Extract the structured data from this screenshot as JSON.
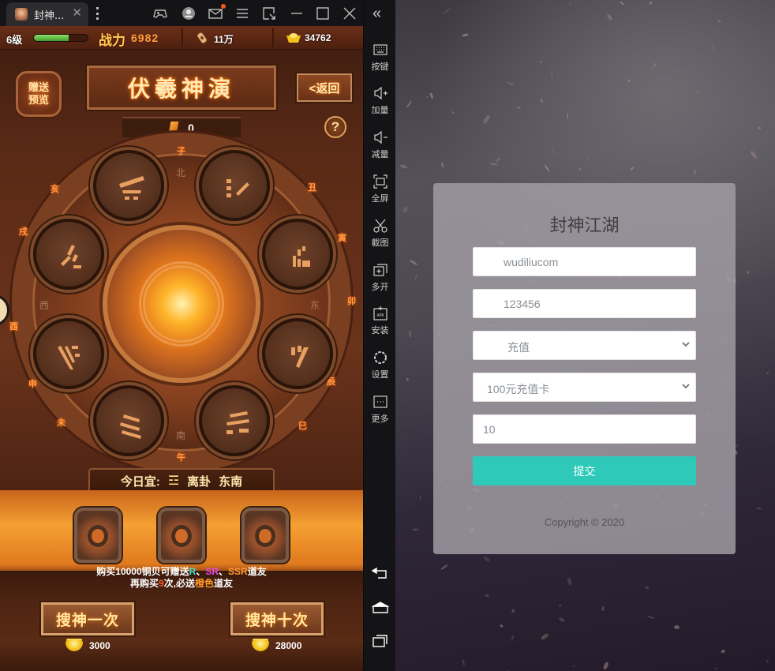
{
  "emulator": {
    "tab_title": "封神...",
    "tab_close": "✕",
    "toolbar_icons": [
      "gamepad-icon",
      "account-icon",
      "mail-icon",
      "menu-icon",
      "resize-icon",
      "minimize-icon",
      "maximize-icon",
      "close-icon"
    ],
    "collapse_glyph": "«",
    "sidebar": [
      {
        "icon": "keyboard-icon",
        "label": "按键"
      },
      {
        "icon": "volume-up-icon",
        "label": "加量"
      },
      {
        "icon": "volume-down-icon",
        "label": "减量"
      },
      {
        "icon": "fullscreen-icon",
        "label": "全屏"
      },
      {
        "icon": "scissors-icon",
        "label": "截图"
      },
      {
        "icon": "multi-instance-icon",
        "label": "多开"
      },
      {
        "icon": "apk-install-icon",
        "label": "安装"
      },
      {
        "icon": "settings-icon",
        "label": "设置"
      },
      {
        "icon": "more-icon",
        "label": "更多"
      }
    ],
    "nav_buttons": [
      "back-icon",
      "home-icon",
      "recents-icon"
    ]
  },
  "game": {
    "status": {
      "level": "6级",
      "exp_progress": 0.65,
      "power_label": "战力",
      "power_value": "6982",
      "copper": "11万",
      "gold": "34762"
    },
    "gift_preview": [
      "赠送",
      "预览"
    ],
    "title": "伏羲神演",
    "back_label": "<返回",
    "token_count": "0",
    "help_label": "?",
    "zodiac": [
      "子",
      "丑",
      "寅",
      "卯",
      "辰",
      "巳",
      "午",
      "未",
      "申",
      "酉",
      "戌",
      "亥"
    ],
    "directions": [
      "北",
      "东",
      "南",
      "西"
    ],
    "trigrams": [
      "乾",
      "兑",
      "离",
      "震",
      "巽",
      "坎",
      "艮",
      "坤"
    ],
    "today": {
      "label": "今日宜:",
      "glyph": "☲",
      "trigram": "离卦",
      "direction": "东南"
    },
    "notice": {
      "line1_prefix": "购买10000铜贝可赠送",
      "r": "R",
      "sep1": "、",
      "sr": "SR",
      "sep2": "、",
      "ssr": "SSR",
      "line1_suffix": "道友",
      "line2_prefix": "再购买",
      "count": "9",
      "line2_mid": "次,必送",
      "orange": "橙色",
      "line2_suffix": "道友"
    },
    "draw_once": {
      "label": "搜神一次",
      "cost": "3000"
    },
    "draw_ten": {
      "label": "搜神十次",
      "cost": "28000"
    },
    "colors": {
      "r": "#3ee0d0",
      "sr": "#e04ae8",
      "ssr": "#ff9a3a"
    }
  },
  "web": {
    "title": "封神江湖",
    "account_value": "wudiliucom",
    "password_value": "123456",
    "type_select": "充值",
    "product_select": "100元充值卡",
    "quantity_value": "10",
    "submit_label": "提交",
    "copyright": "Copyright © 2020",
    "accent_color": "#2ec9b9"
  }
}
